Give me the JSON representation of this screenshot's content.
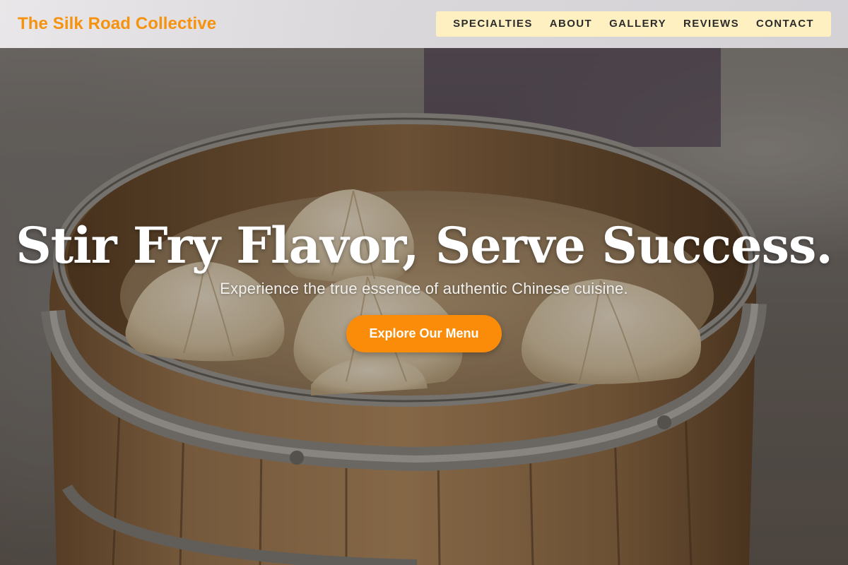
{
  "brand": {
    "name": "The Silk Road Collective",
    "color": "#f5920f"
  },
  "nav": {
    "items": [
      {
        "label": "SPECIALTIES"
      },
      {
        "label": "ABOUT"
      },
      {
        "label": "GALLERY"
      },
      {
        "label": "REVIEWS"
      },
      {
        "label": "CONTACT"
      }
    ],
    "background": "#fff0c2"
  },
  "hero": {
    "headline": "Stir Fry Flavor, Serve Success.",
    "subtitle": "Experience the true essence of authentic Chinese cuisine.",
    "cta_label": "Explore Our Menu",
    "cta_color": "#fb8c0a",
    "image_subject": "dumplings in bamboo steamer"
  }
}
